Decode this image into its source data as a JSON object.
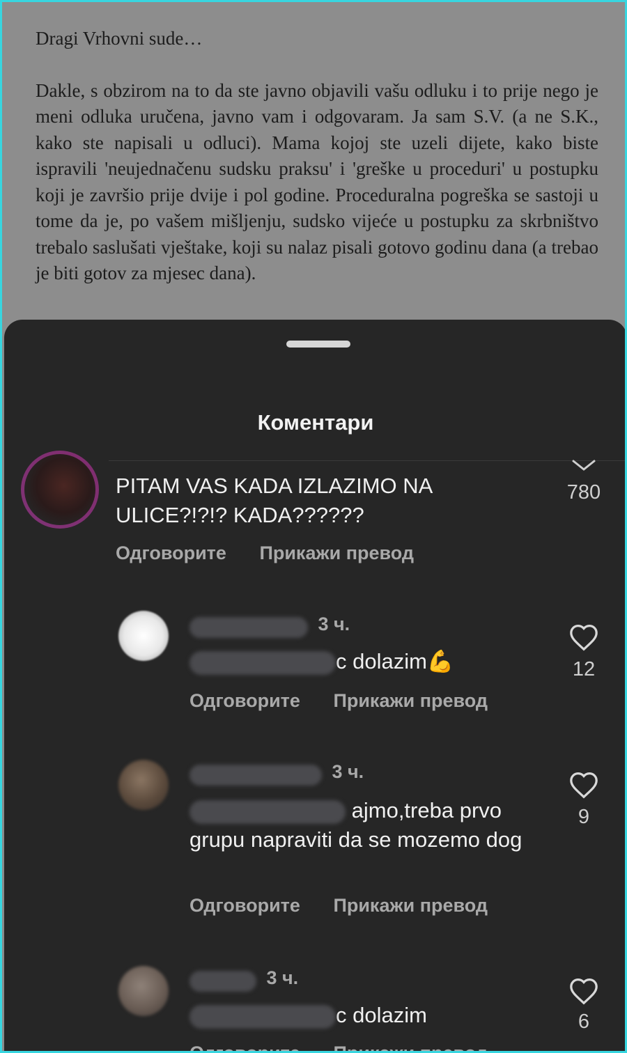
{
  "document": {
    "greeting": "Dragi Vrhovni sude…",
    "paragraph": "Dakle, s obzirom na to da ste javno objavili vašu odluku i to prije nego je meni odluka uručena, javno vam i odgovaram. Ja sam S.V. (a ne S.K., kako ste napisali u odluci). Mama kojoj ste uzeli dijete, kako biste ispravili 'neujednačenu sudsku praksu' i 'greške u proceduri' u postupku koji je završio prije dvije i pol godine. Proceduralna pogreška se sastoji u tome da je, po vašem mišljenju, sudsko vijeće u postupku za skrbništvo trebalo saslušati vještake, koji su nalaz pisali gotovo godinu dana (a trebao je biti gotov za mjesec dana)."
  },
  "sheet": {
    "title": "Коментари"
  },
  "comments": [
    {
      "text": "PITAM VAS KADA IZLAZIMO NA ULICE?!?!? KADA??????",
      "reply": "Одговорите",
      "translate": "Прикажи превод",
      "likes": "780"
    },
    {
      "time": "3 ч.",
      "text": "c dolazim💪",
      "reply": "Одговорите",
      "translate": "Прикажи превод",
      "likes": "12"
    },
    {
      "time": "3 ч.",
      "text_line1": "ajmo,treba prvo",
      "text_rest": "grupu napraviti da se mozemo dog",
      "reply": "Одговорите",
      "translate": "Прикажи превод",
      "likes": "9"
    },
    {
      "time": "3 ч.",
      "text": "c dolazim",
      "reply": "Одговорите",
      "translate": "Прикажи превод",
      "likes": "6"
    }
  ],
  "icons": [
    "heart-icon",
    "chevron-down-icon"
  ],
  "colors": {
    "sheet_bg": "#262626",
    "border_accent": "#37d6e0",
    "muted_text": "#a9a9a9"
  }
}
